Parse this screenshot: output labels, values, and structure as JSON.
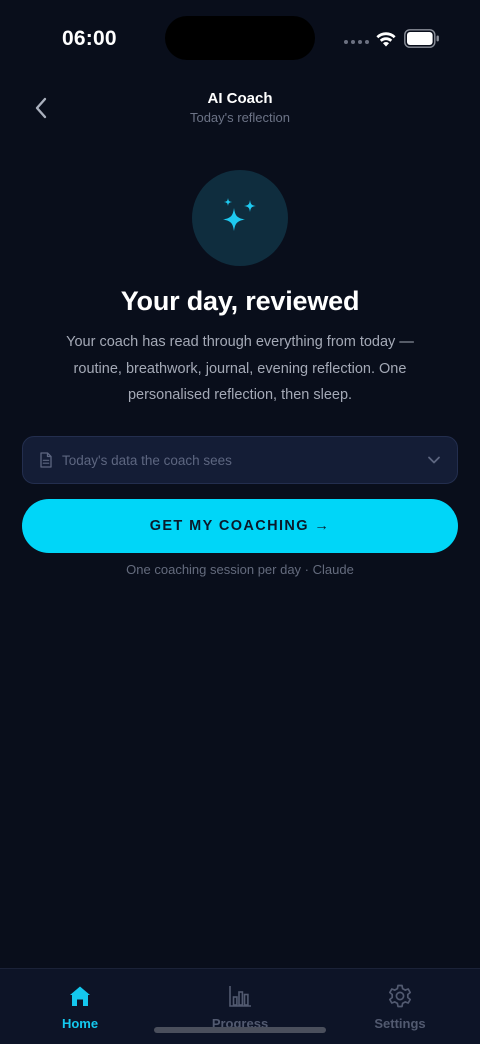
{
  "status_bar": {
    "time": "06:00"
  },
  "header": {
    "title": "AI Coach",
    "subtitle": "Today's reflection",
    "back_icon": "chevron-left-icon"
  },
  "hero": {
    "icon": "sparkles-icon",
    "title": "Your day, reviewed",
    "description": "Your coach has read through everything from today — routine, breathwork, journal, evening reflection. One personalised reflection, then sleep."
  },
  "data_disclosure": {
    "icon": "document-icon",
    "label": "Today's data the coach sees",
    "expand_icon": "chevron-down-icon"
  },
  "cta": {
    "label": "GET MY COACHING →",
    "note": "One coaching session per day · Claude"
  },
  "tab_bar": {
    "tabs": [
      {
        "label": "Home",
        "icon": "home-icon",
        "active": true
      },
      {
        "label": "Progress",
        "icon": "bar-chart-icon",
        "active": false
      },
      {
        "label": "Settings",
        "icon": "gear-icon",
        "active": false
      }
    ]
  },
  "colors": {
    "background": "#090e1b",
    "accent": "#00d6f8",
    "accent_active_tab": "#14c8ee",
    "muted_text": "#a4a9b6",
    "card": "#141d36"
  }
}
